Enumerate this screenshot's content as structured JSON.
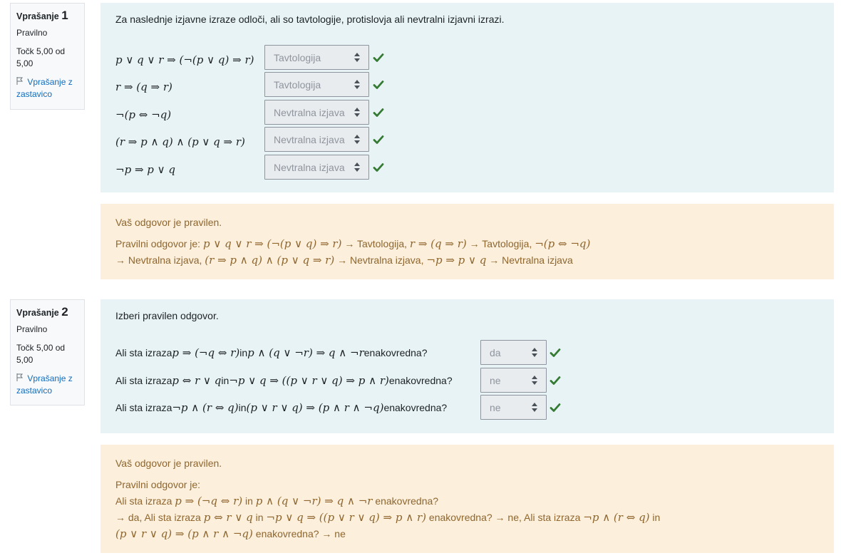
{
  "q1": {
    "info": {
      "label": "Vprašanje",
      "number": "1",
      "state": "Pravilno",
      "grade_line1": "Točk 5,00 od",
      "grade_line2": "5,00",
      "flag_line1": "Vprašanje z",
      "flag_line2": "zastavico"
    },
    "question_text": "Za naslednje izjavne izraze odloči, ali so tavtologije, protislovja ali nevtralni izjavni izrazi.",
    "rows": [
      {
        "stem": "p ∨ q ∨ r ⇒ (¬(p ∨ q) ⇒ r)",
        "answer": "Tavtologija"
      },
      {
        "stem": "r ⇒ (q ⇒ r)",
        "answer": "Tavtologija"
      },
      {
        "stem": "¬(p ⇔ ¬q)",
        "answer": "Nevtralna izjava"
      },
      {
        "stem": "(r ⇒ p ∧ q) ∧ (p ∨ q ⇒ r)",
        "answer": "Nevtralna izjava"
      },
      {
        "stem": "¬p ⇒ p ∨ q",
        "answer": "Nevtralna izjava"
      }
    ],
    "feedback": {
      "correct_msg": "Vaš odgovor je pravilen.",
      "right_prefix": "Pravilni odgovor je: ",
      "a1_stem": "p ∨ q ∨ r ⇒ (¬(p ∨ q) ⇒ r)",
      "a1_ans": " → Tavtologija, ",
      "a2_stem": "r ⇒ (q ⇒ r)",
      "a2_ans": " → Tavtologija, ",
      "a3_stem": "¬(p ⇔ ¬q)",
      "a3_ans": "→ Nevtralna izjava, ",
      "a4_stem": "(r ⇒ p ∧ q) ∧ (p ∨ q ⇒ r)",
      "a4_ans": " → Nevtralna izjava, ",
      "a5_stem": "¬p ⇒ p ∨ q",
      "a5_ans": " → Nevtralna izjava"
    }
  },
  "q2": {
    "info": {
      "label": "Vprašanje",
      "number": "2",
      "state": "Pravilno",
      "grade_line1": "Točk 5,00 od",
      "grade_line2": "5,00",
      "flag_line1": "Vprašanje z",
      "flag_line2": "zastavico"
    },
    "question_text": "Izberi pravilen odgovor.",
    "rows": [
      {
        "pre": "Ali sta izraza ",
        "m1": "p ⇒ (¬q ⇔ r)",
        "mid": " in ",
        "m2": "p ∧ (q ∨ ¬r) ⇒ q ∧ ¬r",
        "post": " enakovredna?",
        "answer": "da"
      },
      {
        "pre": "Ali sta izraza ",
        "m1": "p ⇔ r ∨ q",
        "mid": " in ",
        "m2": "¬p ∨ q ⇒ ((p ∨ r ∨ q) ⇒ p ∧ r)",
        "post": " enakovredna?",
        "answer": "ne"
      },
      {
        "pre": "Ali sta izraza ",
        "m1": "¬p ∧ (r ⇔ q)",
        "mid": " in ",
        "m2": "(p ∨ r ∨ q) ⇒ (p ∧ r ∧ ¬q)",
        "post": " enakovredna?",
        "answer": "ne"
      }
    ],
    "feedback": {
      "correct_msg": "Vaš odgovor je pravilen.",
      "right_prefix": "Pravilni odgovor je:",
      "l1_pre": "Ali sta izraza ",
      "l1_m1": "p ⇒ (¬q ⇔ r)",
      "l1_mid": " in ",
      "l1_m2": "p ∧ (q ∨ ¬r) ⇒ q ∧ ¬r",
      "l1_post": " enakovredna?",
      "l2_pre": "→ da, Ali sta izraza ",
      "l2_m1": "p ⇔ r ∨ q",
      "l2_mid": " in ",
      "l2_m2": "¬p ∨ q ⇒ ((p ∨ r ∨ q) ⇒ p ∧ r)",
      "l2_post": " enakovredna? → ne, Ali sta izraza ",
      "l2_m3": "¬p ∧ (r ⇔ q)",
      "l2_end": " in",
      "l3_m1": "(p ∨ r ∨ q) ⇒ (p ∧ r ∧ ¬q)",
      "l3_post": " enakovredna? → ne"
    }
  },
  "colors": {
    "correct": "#357a32",
    "formulation_bg": "#e7f3f5",
    "feedback_bg": "#fcefdc",
    "link": "#0f6cbf"
  }
}
